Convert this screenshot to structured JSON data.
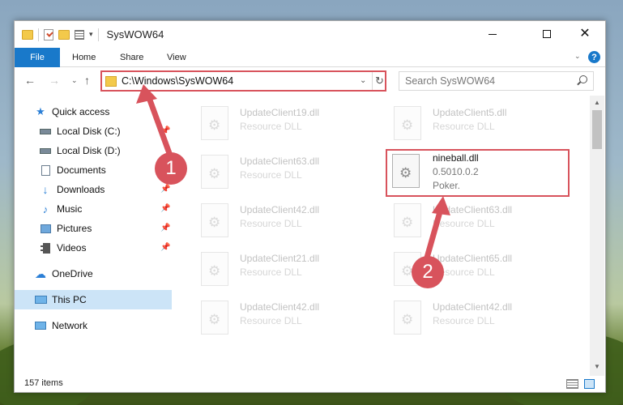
{
  "window": {
    "title": "SysWOW64"
  },
  "ribbon": {
    "file": "File",
    "home": "Home",
    "share": "Share",
    "view": "View"
  },
  "navbar": {
    "path": "C:\\Windows\\SysWOW64",
    "search_placeholder": "Search SysWOW64"
  },
  "sidebar": {
    "items": [
      {
        "label": "Quick access",
        "icon": "star-icon"
      },
      {
        "label": "Local Disk (C:)",
        "icon": "drive-icon"
      },
      {
        "label": "Local Disk (D:)",
        "icon": "drive-icon"
      },
      {
        "label": "Documents",
        "icon": "documents-icon"
      },
      {
        "label": "Downloads",
        "icon": "download-icon"
      },
      {
        "label": "Music",
        "icon": "music-icon"
      },
      {
        "label": "Pictures",
        "icon": "pictures-icon"
      },
      {
        "label": "Videos",
        "icon": "videos-icon"
      },
      {
        "label": "OneDrive",
        "icon": "cloud-icon"
      },
      {
        "label": "This PC",
        "icon": "computer-icon"
      },
      {
        "label": "Network",
        "icon": "network-icon"
      }
    ]
  },
  "files": [
    {
      "name": "UpdateClient19.dll",
      "sub": "Resource DLL"
    },
    {
      "name": "UpdateClient5.dll",
      "sub": "Resource DLL"
    },
    {
      "name": "UpdateClient63.dll",
      "sub": "Resource DLL"
    },
    {
      "name": "nineball.dll",
      "version": "0.5010.0.2",
      "desc": "Poker."
    },
    {
      "name": "UpdateClient42.dll",
      "sub": "Resource DLL"
    },
    {
      "name": "UpdateClient63.dll",
      "sub": "Resource DLL"
    },
    {
      "name": "UpdateClient21.dll",
      "sub": "Resource DLL"
    },
    {
      "name": "UpdateClient65.dll",
      "sub": "Resource DLL"
    },
    {
      "name": "UpdateClient42.dll",
      "sub": "Resource DLL"
    },
    {
      "name": "UpdateClient42.dll",
      "sub": "Resource DLL"
    }
  ],
  "status": {
    "count": "157 items"
  },
  "annotations": {
    "step1": "1",
    "step2": "2",
    "color": "#d8535c"
  }
}
